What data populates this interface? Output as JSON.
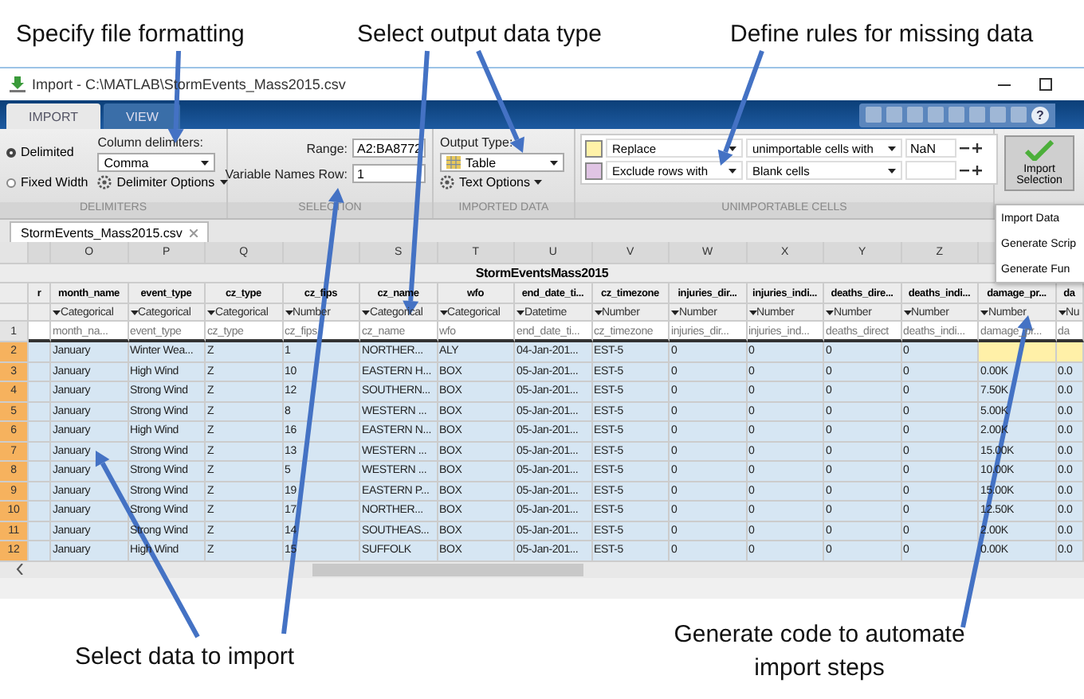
{
  "callouts_top": [
    "Specify file formatting",
    "Select output data type",
    "Define rules for missing data"
  ],
  "callouts_bottom": [
    "Select data to import",
    "Generate code to automate import steps"
  ],
  "window": {
    "title": "Import - C:\\MATLAB\\StormEvents_Mass2015.csv",
    "help_glyph": "?"
  },
  "tabs": [
    {
      "label": "IMPORT",
      "selected": true
    },
    {
      "label": "VIEW",
      "selected": false
    }
  ],
  "delimiters": {
    "radios": [
      {
        "label": "Delimited",
        "selected": true
      },
      {
        "label": "Fixed Width",
        "selected": false
      }
    ],
    "column_label": "Column delimiters:",
    "column_value": "Comma",
    "options_button": "Delimiter Options",
    "section": "DELIMITERS"
  },
  "selection": {
    "range_label": "Range:",
    "range_value": "A2:BA8772",
    "names_label": "Variable Names Row:",
    "names_value": "1",
    "section": "SELECTION"
  },
  "imported_data": {
    "label": "Output Type:",
    "value": "Table",
    "options_button": "Text Options",
    "section": "IMPORTED DATA"
  },
  "unimportable": {
    "section": "UNIMPORTABLE CELLS",
    "rules": [
      {
        "color": "#fff2a8",
        "action": "Replace",
        "target": "unimportable cells with",
        "value": "NaN"
      },
      {
        "color": "#e0c4e4",
        "action": "Exclude rows with",
        "target": "Blank cells"
      }
    ]
  },
  "import_button": {
    "label": "Import Selection"
  },
  "import_menu": [
    "Import Data",
    "Generate Scrip",
    "Generate Fun"
  ],
  "document_tab": "StormEvents_Mass2015.csv",
  "grid": {
    "title": "StormEventsMass2015",
    "leading_column": "r",
    "hint_row_number": "1",
    "columns": [
      {
        "letter": "O",
        "name": "month_name",
        "type": "Categorical",
        "hint": "month_na..."
      },
      {
        "letter": "P",
        "name": "event_type",
        "type": "Categorical",
        "hint": "event_type"
      },
      {
        "letter": "Q",
        "name": "cz_type",
        "type": "Categorical",
        "hint": "cz_type"
      },
      {
        "name": "cz_fips",
        "type": "Number",
        "hint": "cz_fips"
      },
      {
        "letter": "S",
        "name": "cz_name",
        "type": "Categorical",
        "hint": "cz_name"
      },
      {
        "letter": "T",
        "name": "wfo",
        "type": "Categorical",
        "hint": "wfo"
      },
      {
        "letter": "U",
        "name": "end_date_ti...",
        "type": "Datetime",
        "hint": "end_date_ti..."
      },
      {
        "letter": "V",
        "name": "cz_timezone",
        "type": "Number",
        "hint": "cz_timezone"
      },
      {
        "letter": "W",
        "name": "injuries_dir...",
        "type": "Number",
        "hint": "injuries_dir..."
      },
      {
        "letter": "X",
        "name": "injuries_indi...",
        "type": "Number",
        "hint": "injuries_ind..."
      },
      {
        "letter": "Y",
        "name": "deaths_dire...",
        "type": "Number",
        "hint": "deaths_direct"
      },
      {
        "letter": "Z",
        "name": "deaths_indi...",
        "type": "Number",
        "hint": "deaths_indi..."
      },
      {
        "name": "damage_pr...",
        "type": "Number",
        "hint": "damage_pr..."
      },
      {
        "name": "da",
        "type": "Nu",
        "hint": "da"
      }
    ],
    "rows": [
      {
        "number": "2",
        "cells": [
          "January",
          "Winter Wea...",
          "Z",
          "1",
          "NORTHER...",
          "ALY",
          "04-Jan-201...",
          "EST-5",
          "0",
          "0",
          "0",
          "0"
        ]
      },
      {
        "number": "3",
        "cells": [
          "January",
          "High Wind",
          "Z",
          "10",
          "EASTERN H...",
          "BOX",
          "05-Jan-201...",
          "EST-5",
          "0",
          "0",
          "0",
          "0",
          "0.00K",
          "0.0"
        ]
      },
      {
        "number": "4",
        "cells": [
          "January",
          "Strong Wind",
          "Z",
          "12",
          "SOUTHERN...",
          "BOX",
          "05-Jan-201...",
          "EST-5",
          "0",
          "0",
          "0",
          "0",
          "7.50K",
          "0.0"
        ]
      },
      {
        "number": "5",
        "cells": [
          "January",
          "Strong Wind",
          "Z",
          "8",
          "WESTERN ...",
          "BOX",
          "05-Jan-201...",
          "EST-5",
          "0",
          "0",
          "0",
          "0",
          "5.00K",
          "0.0"
        ]
      },
      {
        "number": "6",
        "cells": [
          "January",
          "High Wind",
          "Z",
          "16",
          "EASTERN N...",
          "BOX",
          "05-Jan-201...",
          "EST-5",
          "0",
          "0",
          "0",
          "0",
          "2.00K",
          "0.0"
        ]
      },
      {
        "number": "7",
        "cells": [
          "January",
          "Strong Wind",
          "Z",
          "13",
          "WESTERN ...",
          "BOX",
          "05-Jan-201...",
          "EST-5",
          "0",
          "0",
          "0",
          "0",
          "15.00K",
          "0.0"
        ]
      },
      {
        "number": "8",
        "cells": [
          "January",
          "Strong Wind",
          "Z",
          "5",
          "WESTERN ...",
          "BOX",
          "05-Jan-201...",
          "EST-5",
          "0",
          "0",
          "0",
          "0",
          "10.00K",
          "0.0"
        ]
      },
      {
        "number": "9",
        "cells": [
          "January",
          "Strong Wind",
          "Z",
          "19",
          "EASTERN P...",
          "BOX",
          "05-Jan-201...",
          "EST-5",
          "0",
          "0",
          "0",
          "0",
          "15.00K",
          "0.0"
        ]
      },
      {
        "number": "10",
        "cells": [
          "January",
          "Strong Wind",
          "Z",
          "17",
          "NORTHER...",
          "BOX",
          "05-Jan-201...",
          "EST-5",
          "0",
          "0",
          "0",
          "0",
          "12.50K",
          "0.0"
        ]
      },
      {
        "number": "11",
        "cells": [
          "January",
          "Strong Wind",
          "Z",
          "14",
          "SOUTHEAS...",
          "BOX",
          "05-Jan-201...",
          "EST-5",
          "0",
          "0",
          "0",
          "0",
          "2.00K",
          "0.0"
        ]
      },
      {
        "number": "12",
        "cells": [
          "January",
          "High Wind",
          "Z",
          "15",
          "SUFFOLK",
          "BOX",
          "05-Jan-201...",
          "EST-5",
          "0",
          "0",
          "0",
          "0",
          "0.00K",
          "0.0"
        ]
      }
    ]
  }
}
